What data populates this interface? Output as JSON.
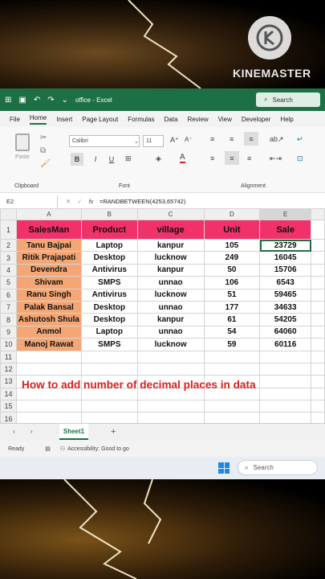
{
  "overlay": {
    "brand": "KINEMASTER"
  },
  "title": {
    "doc": "office - Excel",
    "search": "Search"
  },
  "menu": [
    "File",
    "Home",
    "Insert",
    "Page Layout",
    "Formulas",
    "Data",
    "Review",
    "View",
    "Developer",
    "Help"
  ],
  "ribbon": {
    "paste": "Paste",
    "clipboard": "Clipboard",
    "font_name": "Calibri",
    "font_size": "11",
    "font": "Font",
    "alignment": "Alignment",
    "bold": "B",
    "italic": "I",
    "underline": "U"
  },
  "formula_bar": {
    "cell": "E2",
    "fx": "fx",
    "formula": "=RANDBETWEEN(4253,65742)"
  },
  "columns": [
    "A",
    "B",
    "C",
    "D",
    "E"
  ],
  "headers": [
    "SalesMan",
    "Product",
    "village",
    "Unit",
    "Sale"
  ],
  "rows": [
    [
      "Tanu Bajpai",
      "Laptop",
      "kanpur",
      "105",
      "23729"
    ],
    [
      "Ritik Prajapati",
      "Desktop",
      "lucknow",
      "249",
      "16045"
    ],
    [
      "Devendra",
      "Antivirus",
      "kanpur",
      "50",
      "15706"
    ],
    [
      "Shivam",
      "SMPS",
      "unnao",
      "106",
      "6543"
    ],
    [
      "Ranu Singh",
      "Antivirus",
      "lucknow",
      "51",
      "59465"
    ],
    [
      "Palak Bansal",
      "Desktop",
      "unnao",
      "177",
      "34633"
    ],
    [
      "Ashutosh Shula",
      "Desktop",
      "kanpur",
      "61",
      "54205"
    ],
    [
      "Anmol",
      "Laptop",
      "unnao",
      "54",
      "64060"
    ],
    [
      "Manoj Rawat",
      "SMPS",
      "lucknow",
      "59",
      "60116"
    ]
  ],
  "row_numbers": [
    "1",
    "2",
    "3",
    "4",
    "5",
    "6",
    "7",
    "8",
    "9",
    "10",
    "11",
    "12",
    "13",
    "14",
    "15",
    "16"
  ],
  "banner": "How to add number of decimal places in data",
  "sheet_tab": "Sheet1",
  "add_sheet": "+",
  "status": {
    "ready": "Ready",
    "accessibility": "Accessibility: Good to go"
  },
  "taskbar": {
    "search": "Search"
  },
  "colors": {
    "header_fill": "#f0316a",
    "name_fill": "#f4a774",
    "excel_green": "#1d7044",
    "banner_red": "#d8201f"
  }
}
